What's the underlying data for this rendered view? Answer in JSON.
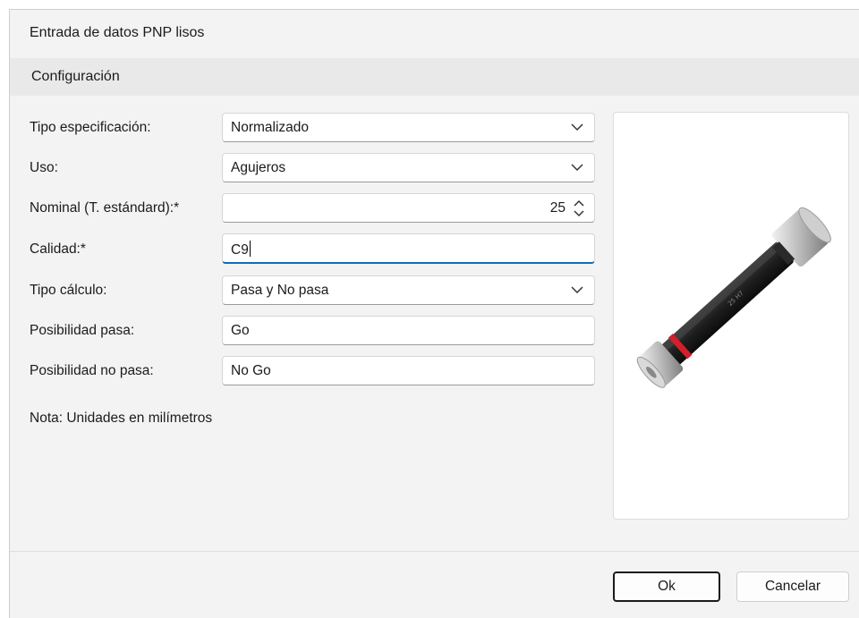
{
  "window": {
    "title": "Entrada de datos PNP lisos"
  },
  "section": {
    "label": "Configuración"
  },
  "form": {
    "tipo_especificacion": {
      "label": "Tipo especificación:",
      "value": "Normalizado"
    },
    "uso": {
      "label": "Uso:",
      "value": "Agujeros"
    },
    "nominal": {
      "label": "Nominal (T. estándard):*",
      "value": "25"
    },
    "calidad": {
      "label": "Calidad:*",
      "value": "C9"
    },
    "tipo_calculo": {
      "label": "Tipo cálculo:",
      "value": "Pasa y No pasa"
    },
    "posibilidad_pasa": {
      "label": "Posibilidad pasa:",
      "value": "Go"
    },
    "posibilidad_no_pasa": {
      "label": "Posibilidad no pasa:",
      "value": "No Go"
    }
  },
  "note": "Nota: Unidades en milímetros",
  "buttons": {
    "ok": "Ok",
    "cancel": "Cancelar"
  },
  "icons": {
    "dropdown": "chevron-down-icon",
    "spin": "spin-updown-icon"
  },
  "colors": {
    "focus_accent": "#0f6cbd",
    "gauge_red_ring": "#d0202a"
  }
}
